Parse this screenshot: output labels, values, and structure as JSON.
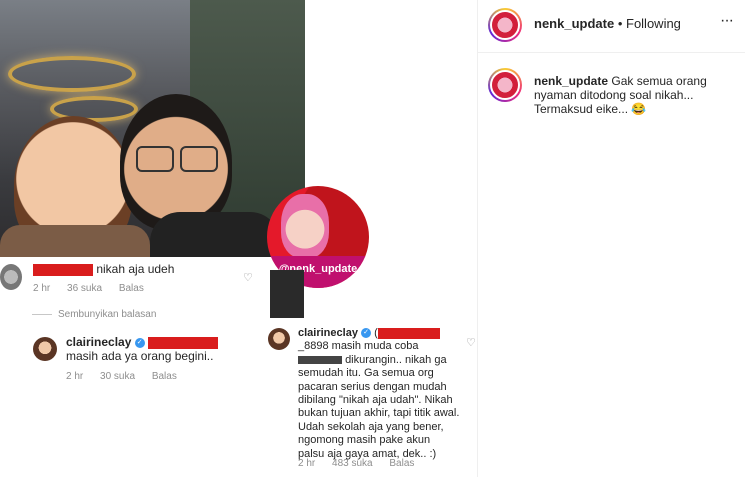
{
  "post": {
    "logo_text": "@nenk_update"
  },
  "comments": {
    "first": {
      "text": "nikah aja udeh",
      "time": "2 hr",
      "likes": "36 suka",
      "reply": "Balas"
    },
    "hide_replies": "Sembunyikan balasan",
    "reply1": {
      "username": "clairineclay",
      "text": "masih ada ya orang begini..",
      "time": "2 hr",
      "likes": "30 suka",
      "reply": "Balas"
    },
    "reply2": {
      "username": "clairineclay",
      "handle_suffix": "_8898",
      "text_line1": "masih muda coba",
      "text_line2": "dikurangin.. nikah ga",
      "text_line3": "semudah itu. Ga semua org",
      "text_line4": "pacaran serius dengan mudah",
      "text_line5": "dibilang \"nikah aja udah\". Nikah",
      "text_line6": "bukan tujuan akhir, tapi titik awal.",
      "text_line7": "Udah sekolah aja yang bener,",
      "text_line8": "ngomong masih pake akun",
      "text_line9": "palsu aja gaya amat, dek.. :)",
      "time": "2 hr",
      "likes": "483 suka",
      "reply": "Balas"
    }
  },
  "sidebar": {
    "username": "nenk_update",
    "separator": "•",
    "follow_status": "Following",
    "more": "···",
    "caption_username": "nenk_update",
    "caption_line1": "Gak semua orang",
    "caption_line2": "nyaman ditodong soal nikah...",
    "caption_line3": "Termaksud eike...",
    "caption_emoji": "😂"
  },
  "colors": {
    "redaction": "#d91d1d",
    "verified": "#3897f0",
    "muted": "#8e8e8e",
    "logo_band": "#c0106e"
  }
}
